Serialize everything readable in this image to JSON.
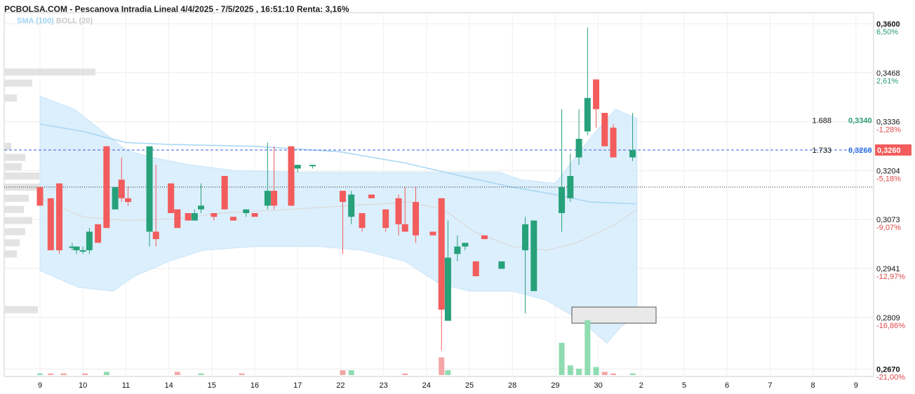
{
  "header": {
    "title": "PCBOLSA.COM - Pescanova Intradia Lineal 4/4/2025 - 7/5/2025 , 16:51:10 Renta: 3,16%",
    "indicator_sma": "SMA (100)",
    "indicator_boll": "BOLL (20)"
  },
  "colors": {
    "up": "#26a17a",
    "down": "#f25c5c",
    "band_fill": "#d6ecfb",
    "sma_line": "#a9d8f4",
    "boll_mid": "#d9d9d9",
    "current_line": "#3a5be0",
    "green_text": "#2a9d6e",
    "red_text": "#e04848",
    "blue_text": "#2d6fe0"
  },
  "chart_data": {
    "type": "candlestick",
    "title": "PCBOLSA.COM - Pescanova Intradia Lineal 4/4/2025 - 7/5/2025 , 16:51:10 Renta: 3,16%",
    "ylim": [
      0.265,
      0.363
    ],
    "x_tick_labels": [
      "9",
      "10",
      "11",
      "14",
      "15",
      "16",
      "17",
      "22",
      "23",
      "24",
      "25",
      "28",
      "29",
      "30",
      "2",
      "5",
      "6",
      "7",
      "8",
      "9"
    ],
    "y_ticks": [
      {
        "value": 0.36,
        "label": "0,3600",
        "pct": "6,50%",
        "pct_dir": "up"
      },
      {
        "value": 0.3468,
        "label": "0,3468",
        "pct": "2,61%",
        "pct_dir": "up"
      },
      {
        "value": 0.3336,
        "label": "0,3336",
        "pct": "-1,28%",
        "pct_dir": "down"
      },
      {
        "value": 0.3204,
        "label": "0,3204",
        "pct": "-5,18%",
        "pct_dir": "down"
      },
      {
        "value": 0.3073,
        "label": "0,3073",
        "pct": "-9,07%",
        "pct_dir": "down"
      },
      {
        "value": 0.2941,
        "label": "0,2941",
        "pct": "-12,97%",
        "pct_dir": "down"
      },
      {
        "value": 0.2809,
        "label": "0,2809",
        "pct": "-16,86%",
        "pct_dir": "down"
      },
      {
        "value": 0.267,
        "label": "0,2670",
        "pct": "-21,00%",
        "pct_dir": "down"
      }
    ],
    "current_price": {
      "value": 0.326,
      "label": "0,3260"
    },
    "reference_line": 0.316,
    "price_labels": [
      {
        "qty": "1.688",
        "price": "0,3340",
        "value": 0.334,
        "style": "green"
      },
      {
        "qty": "1.733",
        "price": "0,3260",
        "value": 0.326,
        "style": "blue"
      }
    ],
    "candles": [
      {
        "slot": 0.0,
        "o": 0.316,
        "h": 0.316,
        "l": 0.312,
        "c": 0.311
      },
      {
        "slot": 0.25,
        "o": 0.313,
        "h": 0.313,
        "l": 0.299,
        "c": 0.299
      },
      {
        "slot": 0.45,
        "o": 0.317,
        "h": 0.317,
        "l": 0.298,
        "c": 0.299
      },
      {
        "slot": 0.75,
        "o": 0.3,
        "h": 0.301,
        "l": 0.299,
        "c": 0.3
      },
      {
        "slot": 0.85,
        "o": 0.299,
        "h": 0.3,
        "l": 0.298,
        "c": 0.3
      },
      {
        "slot": 1.0,
        "o": 0.299,
        "h": 0.3,
        "l": 0.298,
        "c": 0.299
      },
      {
        "slot": 1.15,
        "o": 0.299,
        "h": 0.305,
        "l": 0.298,
        "c": 0.304
      },
      {
        "slot": 1.35,
        "o": 0.306,
        "h": 0.306,
        "l": 0.301,
        "c": 0.301
      },
      {
        "slot": 1.55,
        "o": 0.327,
        "h": 0.327,
        "l": 0.305,
        "c": 0.305
      },
      {
        "slot": 1.75,
        "o": 0.31,
        "h": 0.316,
        "l": 0.31,
        "c": 0.316
      },
      {
        "slot": 1.9,
        "o": 0.318,
        "h": 0.324,
        "l": 0.312,
        "c": 0.313
      },
      {
        "slot": 2.05,
        "o": 0.313,
        "h": 0.316,
        "l": 0.311,
        "c": 0.312
      },
      {
        "slot": 2.55,
        "o": 0.304,
        "h": 0.313,
        "l": 0.3,
        "c": 0.327
      },
      {
        "slot": 2.7,
        "o": 0.304,
        "h": 0.322,
        "l": 0.3,
        "c": 0.302
      },
      {
        "slot": 3.05,
        "o": 0.317,
        "h": 0.317,
        "l": 0.309,
        "c": 0.309
      },
      {
        "slot": 3.2,
        "o": 0.31,
        "h": 0.31,
        "l": 0.305,
        "c": 0.305
      },
      {
        "slot": 3.45,
        "o": 0.309,
        "h": 0.309,
        "l": 0.307,
        "c": 0.307
      },
      {
        "slot": 3.6,
        "o": 0.307,
        "h": 0.31,
        "l": 0.307,
        "c": 0.309
      },
      {
        "slot": 3.75,
        "o": 0.31,
        "h": 0.317,
        "l": 0.309,
        "c": 0.311
      },
      {
        "slot": 4.05,
        "o": 0.309,
        "h": 0.309,
        "l": 0.307,
        "c": 0.308
      },
      {
        "slot": 4.3,
        "o": 0.319,
        "h": 0.319,
        "l": 0.31,
        "c": 0.31
      },
      {
        "slot": 4.5,
        "o": 0.308,
        "h": 0.308,
        "l": 0.307,
        "c": 0.307
      },
      {
        "slot": 4.8,
        "o": 0.309,
        "h": 0.31,
        "l": 0.308,
        "c": 0.31
      },
      {
        "slot": 5.0,
        "o": 0.309,
        "h": 0.309,
        "l": 0.308,
        "c": 0.308
      },
      {
        "slot": 5.3,
        "o": 0.311,
        "h": 0.328,
        "l": 0.31,
        "c": 0.315
      },
      {
        "slot": 5.45,
        "o": 0.315,
        "h": 0.327,
        "l": 0.31,
        "c": 0.311
      },
      {
        "slot": 5.85,
        "o": 0.327,
        "h": 0.327,
        "l": 0.311,
        "c": 0.311
      },
      {
        "slot": 6.0,
        "o": 0.321,
        "h": 0.322,
        "l": 0.32,
        "c": 0.322
      },
      {
        "slot": 6.35,
        "o": 0.322,
        "h": 0.322,
        "l": 0.321,
        "c": 0.322
      },
      {
        "slot": 7.05,
        "o": 0.315,
        "h": 0.315,
        "l": 0.298,
        "c": 0.312
      },
      {
        "slot": 7.25,
        "o": 0.308,
        "h": 0.315,
        "l": 0.306,
        "c": 0.314
      },
      {
        "slot": 7.5,
        "o": 0.309,
        "h": 0.309,
        "l": 0.304,
        "c": 0.305
      },
      {
        "slot": 7.72,
        "o": 0.314,
        "h": 0.314,
        "l": 0.313,
        "c": 0.313
      },
      {
        "slot": 8.05,
        "o": 0.31,
        "h": 0.31,
        "l": 0.304,
        "c": 0.305
      },
      {
        "slot": 8.35,
        "o": 0.313,
        "h": 0.314,
        "l": 0.303,
        "c": 0.306
      },
      {
        "slot": 8.5,
        "o": 0.306,
        "h": 0.316,
        "l": 0.304,
        "c": 0.304
      },
      {
        "slot": 8.75,
        "o": 0.312,
        "h": 0.316,
        "l": 0.301,
        "c": 0.303
      },
      {
        "slot": 9.15,
        "o": 0.304,
        "h": 0.304,
        "l": 0.303,
        "c": 0.303
      },
      {
        "slot": 9.35,
        "o": 0.313,
        "h": 0.313,
        "l": 0.272,
        "c": 0.283
      },
      {
        "slot": 9.5,
        "o": 0.28,
        "h": 0.307,
        "l": 0.28,
        "c": 0.297
      },
      {
        "slot": 9.72,
        "o": 0.298,
        "h": 0.303,
        "l": 0.296,
        "c": 0.3
      },
      {
        "slot": 9.9,
        "o": 0.3,
        "h": 0.301,
        "l": 0.299,
        "c": 0.301
      },
      {
        "slot": 10.15,
        "o": 0.296,
        "h": 0.296,
        "l": 0.292,
        "c": 0.292
      },
      {
        "slot": 10.35,
        "o": 0.303,
        "h": 0.303,
        "l": 0.302,
        "c": 0.302
      },
      {
        "slot": 10.75,
        "o": 0.294,
        "h": 0.296,
        "l": 0.294,
        "c": 0.296
      },
      {
        "slot": 11.3,
        "o": 0.299,
        "h": 0.308,
        "l": 0.282,
        "c": 0.306
      },
      {
        "slot": 11.5,
        "o": 0.288,
        "h": 0.307,
        "l": 0.288,
        "c": 0.307
      },
      {
        "slot": 12.15,
        "o": 0.309,
        "h": 0.337,
        "l": 0.304,
        "c": 0.316
      },
      {
        "slot": 12.35,
        "o": 0.313,
        "h": 0.325,
        "l": 0.312,
        "c": 0.319
      },
      {
        "slot": 12.55,
        "o": 0.324,
        "h": 0.337,
        "l": 0.322,
        "c": 0.329
      },
      {
        "slot": 12.75,
        "o": 0.331,
        "h": 0.359,
        "l": 0.33,
        "c": 0.34
      },
      {
        "slot": 12.95,
        "o": 0.345,
        "h": 0.345,
        "l": 0.332,
        "c": 0.337
      },
      {
        "slot": 13.15,
        "o": 0.336,
        "h": 0.336,
        "l": 0.328,
        "c": 0.327
      },
      {
        "slot": 13.35,
        "o": 0.332,
        "h": 0.333,
        "l": 0.324,
        "c": 0.324
      },
      {
        "slot": 13.8,
        "o": 0.324,
        "h": 0.336,
        "l": 0.323,
        "c": 0.326
      }
    ],
    "volumes": [
      {
        "slot": 0.0,
        "v": 1,
        "dir": "up"
      },
      {
        "slot": 0.25,
        "v": 1,
        "dir": "down"
      },
      {
        "slot": 0.55,
        "v": 1,
        "dir": "down"
      },
      {
        "slot": 1.05,
        "v": 1,
        "dir": "down"
      },
      {
        "slot": 1.55,
        "v": 2,
        "dir": "up"
      },
      {
        "slot": 3.2,
        "v": 2,
        "dir": "down"
      },
      {
        "slot": 3.75,
        "v": 1,
        "dir": "up"
      },
      {
        "slot": 4.7,
        "v": 1,
        "dir": "down"
      },
      {
        "slot": 7.05,
        "v": 3,
        "dir": "down"
      },
      {
        "slot": 7.25,
        "v": 3,
        "dir": "up"
      },
      {
        "slot": 8.5,
        "v": 1,
        "dir": "down"
      },
      {
        "slot": 9.35,
        "v": 11,
        "dir": "down"
      },
      {
        "slot": 9.5,
        "v": 3,
        "dir": "up"
      },
      {
        "slot": 12.15,
        "v": 20,
        "dir": "up"
      },
      {
        "slot": 12.35,
        "v": 6,
        "dir": "up"
      },
      {
        "slot": 12.55,
        "v": 4,
        "dir": "up"
      },
      {
        "slot": 12.75,
        "v": 34,
        "dir": "up"
      },
      {
        "slot": 12.95,
        "v": 5,
        "dir": "up"
      },
      {
        "slot": 13.15,
        "v": 2,
        "dir": "down"
      },
      {
        "slot": 13.35,
        "v": 1,
        "dir": "down"
      },
      {
        "slot": 13.8,
        "v": 1,
        "dir": "up"
      }
    ],
    "bollinger_upper": [
      [
        0.0,
        0.3405
      ],
      [
        0.8,
        0.337
      ],
      [
        2.0,
        0.326
      ],
      [
        2.6,
        0.324
      ],
      [
        3.5,
        0.322
      ],
      [
        4.5,
        0.3205
      ],
      [
        6.0,
        0.32
      ],
      [
        8.0,
        0.32
      ],
      [
        9.5,
        0.32
      ],
      [
        10.7,
        0.32
      ],
      [
        11.2,
        0.318
      ],
      [
        12.0,
        0.317
      ],
      [
        12.8,
        0.329
      ],
      [
        13.4,
        0.337
      ],
      [
        13.9,
        0.3345
      ]
    ],
    "bollinger_lower": [
      [
        0.0,
        0.2935
      ],
      [
        0.9,
        0.289
      ],
      [
        1.7,
        0.288
      ],
      [
        2.2,
        0.292
      ],
      [
        3.0,
        0.296
      ],
      [
        3.8,
        0.299
      ],
      [
        5.0,
        0.3
      ],
      [
        6.5,
        0.3
      ],
      [
        7.5,
        0.299
      ],
      [
        8.5,
        0.296
      ],
      [
        9.3,
        0.29
      ],
      [
        10.0,
        0.288
      ],
      [
        11.0,
        0.288
      ],
      [
        11.8,
        0.2855
      ],
      [
        12.6,
        0.28
      ],
      [
        13.2,
        0.274
      ],
      [
        13.5,
        0.278
      ],
      [
        13.9,
        0.282
      ]
    ],
    "bollinger_mid": [
      [
        0.0,
        0.313
      ],
      [
        1.0,
        0.308
      ],
      [
        2.0,
        0.307
      ],
      [
        3.2,
        0.3075
      ],
      [
        4.2,
        0.309
      ],
      [
        5.8,
        0.31
      ],
      [
        7.2,
        0.311
      ],
      [
        8.6,
        0.312
      ],
      [
        9.4,
        0.31
      ],
      [
        10.1,
        0.304
      ],
      [
        11.0,
        0.3
      ],
      [
        11.8,
        0.299
      ],
      [
        12.5,
        0.301
      ],
      [
        13.4,
        0.306
      ],
      [
        13.9,
        0.31
      ]
    ],
    "sma_100": [
      [
        0.0,
        0.333
      ],
      [
        1.0,
        0.331
      ],
      [
        2.0,
        0.328
      ],
      [
        3.0,
        0.3275
      ],
      [
        5.0,
        0.327
      ],
      [
        7.0,
        0.3255
      ],
      [
        8.5,
        0.3225
      ],
      [
        10.0,
        0.3185
      ],
      [
        11.0,
        0.316
      ],
      [
        12.0,
        0.314
      ],
      [
        12.8,
        0.312
      ],
      [
        13.9,
        0.3115
      ]
    ],
    "volume_profile": [
      {
        "value": 0.347,
        "len": 130
      },
      {
        "value": 0.344,
        "len": 40
      },
      {
        "value": 0.34,
        "len": 18
      },
      {
        "value": 0.327,
        "len": 10
      },
      {
        "value": 0.324,
        "len": 30
      },
      {
        "value": 0.3215,
        "len": 25
      },
      {
        "value": 0.319,
        "len": 50
      },
      {
        "value": 0.316,
        "len": 90
      },
      {
        "value": 0.313,
        "len": 35
      },
      {
        "value": 0.31,
        "len": 28
      },
      {
        "value": 0.307,
        "len": 40
      },
      {
        "value": 0.304,
        "len": 30
      },
      {
        "value": 0.301,
        "len": 22
      },
      {
        "value": 0.298,
        "len": 18
      },
      {
        "value": 0.283,
        "len": 48
      }
    ]
  }
}
